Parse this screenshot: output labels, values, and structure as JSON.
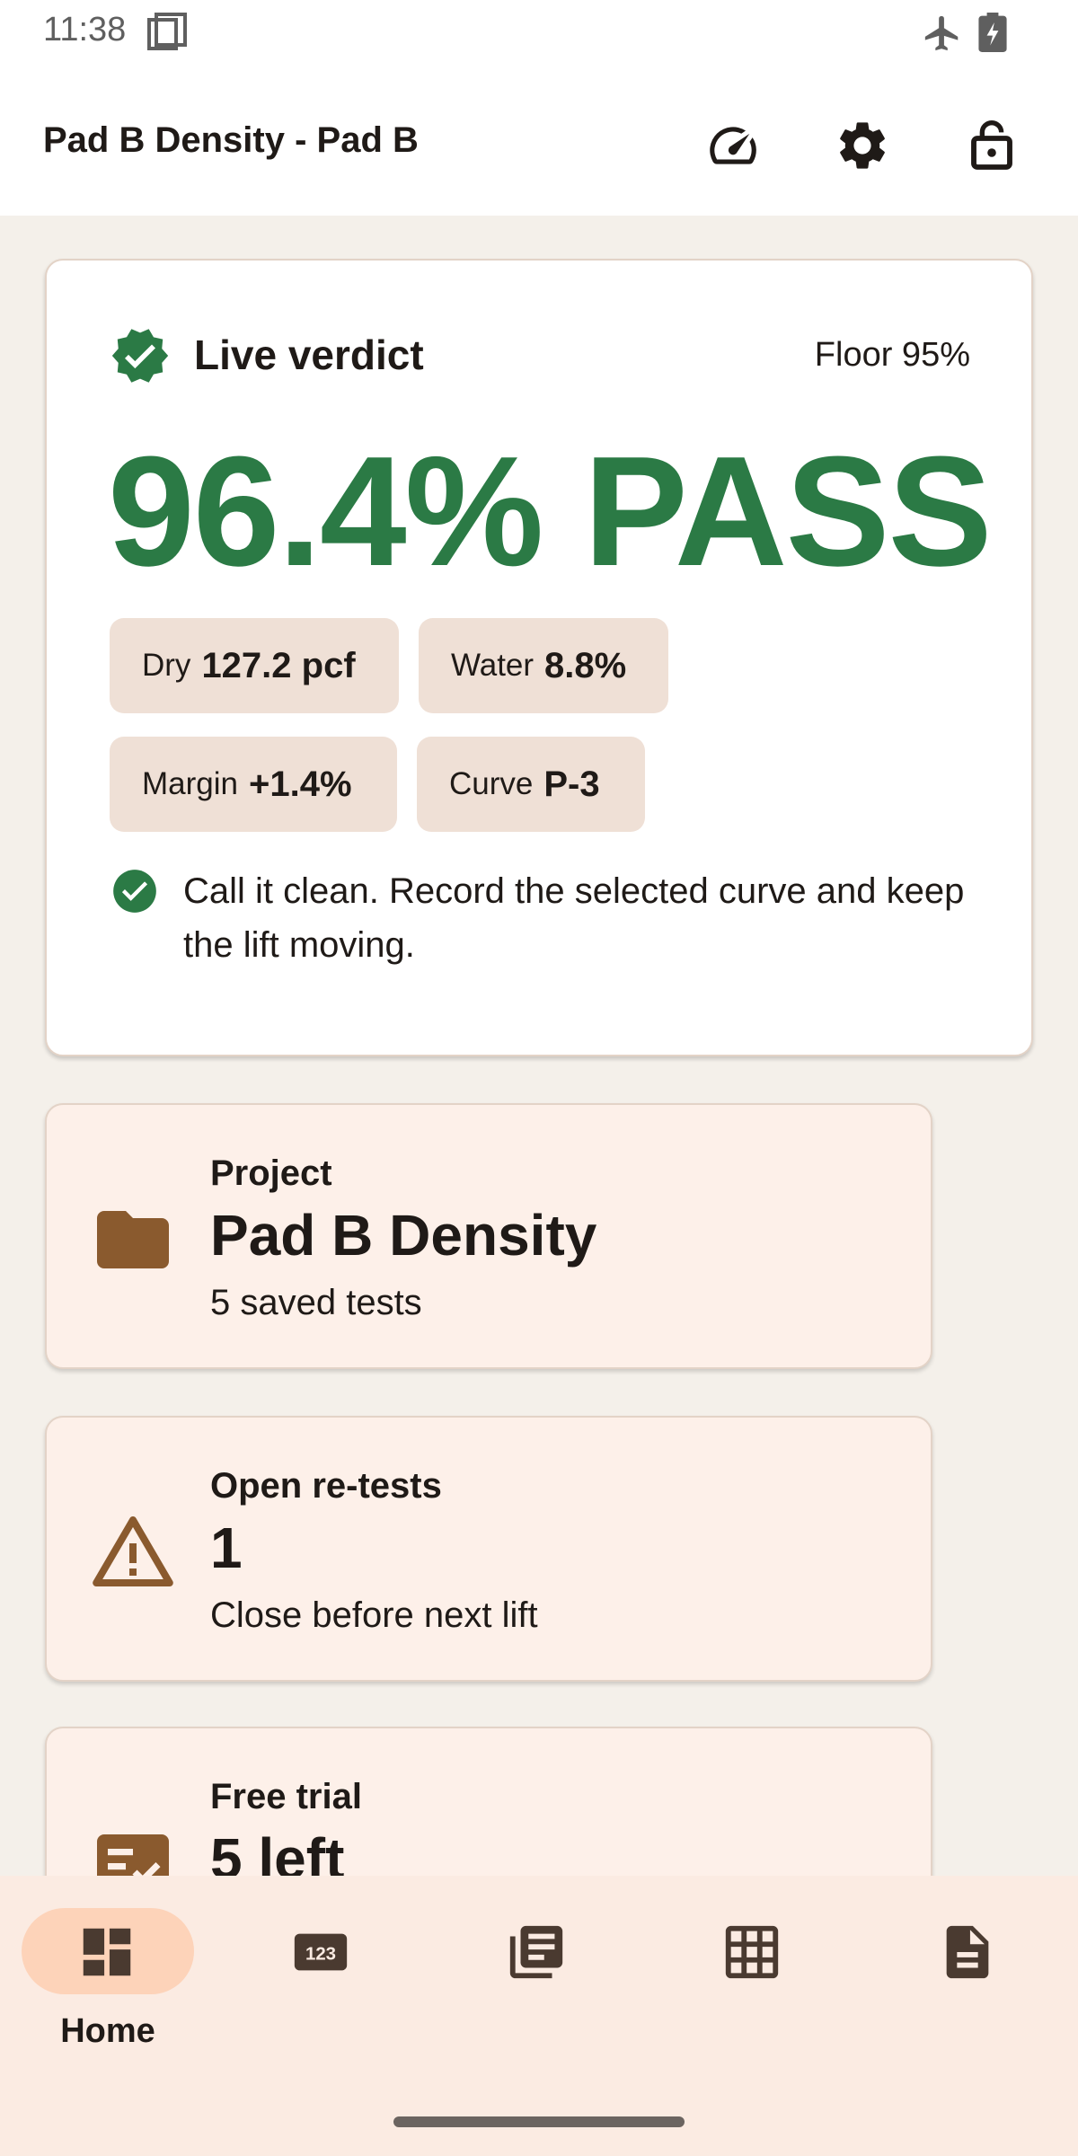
{
  "status_bar": {
    "time": "11:38"
  },
  "app_bar": {
    "title": "Pad B Density - Pad B"
  },
  "verdict": {
    "label": "Live verdict",
    "floor": "Floor 95%",
    "result": "96.4% PASS",
    "chips": {
      "dry": {
        "key": "Dry",
        "value": "127.2 pcf"
      },
      "water": {
        "key": "Water",
        "value": "8.8%"
      },
      "margin": {
        "key": "Margin",
        "value": "+1.4%"
      },
      "curve": {
        "key": "Curve",
        "value": "P-3"
      }
    },
    "note": "Call it clean. Record the selected curve and keep the lift moving.",
    "accent_color": "#2b7a45"
  },
  "cards": {
    "project": {
      "label": "Project",
      "value": "Pad B Density",
      "sub": "5 saved tests"
    },
    "retests": {
      "label": "Open re-tests",
      "value": "1",
      "sub": "Close before next lift"
    },
    "trial": {
      "label": "Free trial",
      "value": "5 left"
    }
  },
  "bottom_nav": {
    "home": {
      "label": "Home"
    }
  },
  "icons": {
    "app_bar": [
      "gauge-icon",
      "gear-icon",
      "lock-icon"
    ],
    "nav": [
      "dashboard-icon",
      "numeric-icon",
      "list-icon",
      "grid-icon",
      "document-icon"
    ]
  },
  "colors": {
    "brand_brown": "#8a5a2e",
    "pass_green": "#2b7a45",
    "nav_pill": "#fdd3b9"
  }
}
